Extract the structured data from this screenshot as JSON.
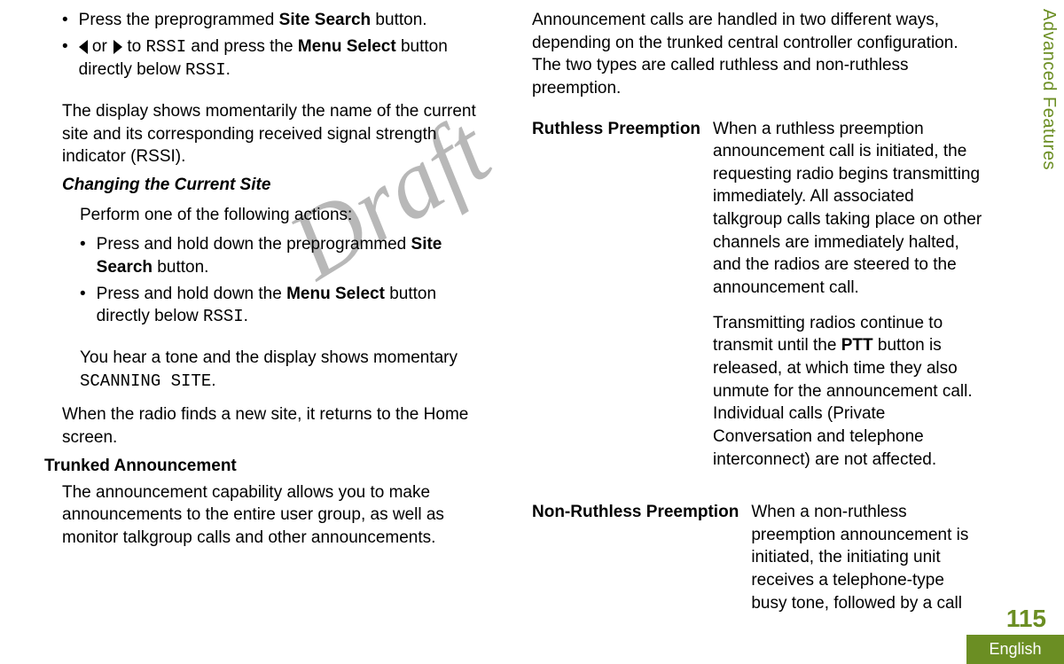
{
  "watermark": "Draft",
  "sideTab": "Advanced Features",
  "pageNumber": "115",
  "language": "English",
  "left": {
    "bullet1_pre": "Press the preprogrammed ",
    "bullet1_bold": "Site Search",
    "bullet1_post": " button.",
    "bullet2_pre": " or ",
    "bullet2_mid": " to ",
    "bullet2_mono1": "RSSI",
    "bullet2_mid2": " and press the ",
    "bullet2_bold": "Menu Select",
    "bullet2_post": " button directly below ",
    "bullet2_mono2": "RSSI",
    "bullet2_end": ".",
    "para1": "The display shows momentarily the name of the current site and its corresponding received signal strength indicator (RSSI).",
    "heading1": "Changing the Current Site",
    "perform": "Perform one of the following actions:",
    "bullet3_pre": "Press and hold down the preprogrammed ",
    "bullet3_bold": "Site Search",
    "bullet3_post": " button.",
    "bullet4_pre": "Press and hold down the ",
    "bullet4_bold": "Menu Select",
    "bullet4_post": " button directly below ",
    "bullet4_mono": "RSSI",
    "bullet4_end": ".",
    "para2_pre": "You hear a tone and the display shows momentary ",
    "para2_mono": "SCANNING SITE",
    "para2_end": ".",
    "para3": "When the radio finds a new site, it returns to the Home screen.",
    "subheading": "Trunked Announcement",
    "para4": "The announcement capability allows you to make announcements to the entire user group, as well as monitor talkgroup calls and other announcements."
  },
  "right": {
    "intro": "Announcement calls are handled in two different ways, depending on the trunked central controller configuration. The two types are called ruthless and non-ruthless preemption.",
    "def1_term": "Ruthless Preemption",
    "def1_p1": "When a ruthless preemption announcement call is initiated, the requesting radio begins transmitting immediately. All associated talkgroup calls taking place on other channels are immediately halted, and the radios are steered to the announcement call.",
    "def1_p2_pre": "Transmitting radios continue to transmit until the ",
    "def1_p2_bold": "PTT",
    "def1_p2_post": " button is released, at which time they also unmute for the announcement call. Individual calls (Private Conversation and telephone interconnect) are not affected.",
    "def2_term": "Non-Ruthless Preemption",
    "def2_p1": "When a non-ruthless preemption announcement is initiated, the initiating unit receives a telephone-type busy tone, followed by a call"
  }
}
